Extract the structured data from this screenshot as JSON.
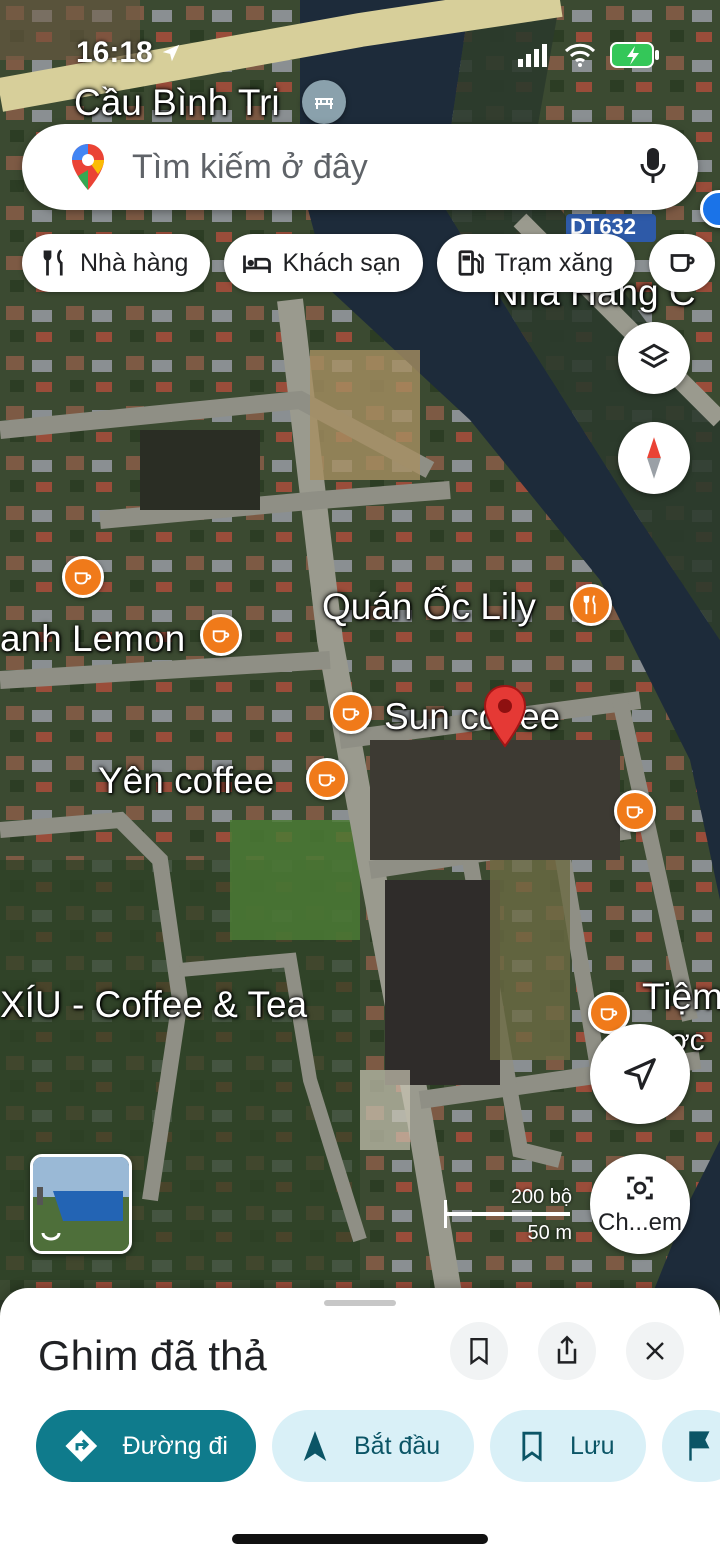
{
  "status": {
    "time": "16:18"
  },
  "search": {
    "placeholder": "Tìm kiếm ở đây"
  },
  "chips": [
    {
      "label": "Nhà hàng",
      "icon": "fork-knife-icon"
    },
    {
      "label": "Khách sạn",
      "icon": "bed-icon"
    },
    {
      "label": "Trạm xăng",
      "icon": "gas-station-icon"
    }
  ],
  "map": {
    "road_labels": {
      "top": "Cầu Bình Tri",
      "route": "DT632"
    },
    "poi": {
      "quan_oc": "Quán Ốc Lily",
      "lemon": "anh Lemon",
      "sun_coffee": "Sun coffee",
      "yen_coffee": "Yên coffee",
      "xiu": "XÍU - Coffee & Tea",
      "tiem": "Tiệm",
      "tiem_sub": "ợc",
      "nha_hang": "Nhà Hàng C"
    },
    "scale": {
      "feet": "200 bộ",
      "meters": "50 m"
    },
    "camera_label": "Ch...em",
    "dropped_pin_color": "#e53935",
    "poi_color": "#f07a1a"
  },
  "sheet": {
    "title": "Ghim đã thả",
    "actions": [
      {
        "label": "Đường đi",
        "icon": "directions-icon"
      },
      {
        "label": "Bắt đầu",
        "icon": "navigation-arrow-icon"
      },
      {
        "label": "Lưu",
        "icon": "bookmark-icon"
      }
    ]
  }
}
